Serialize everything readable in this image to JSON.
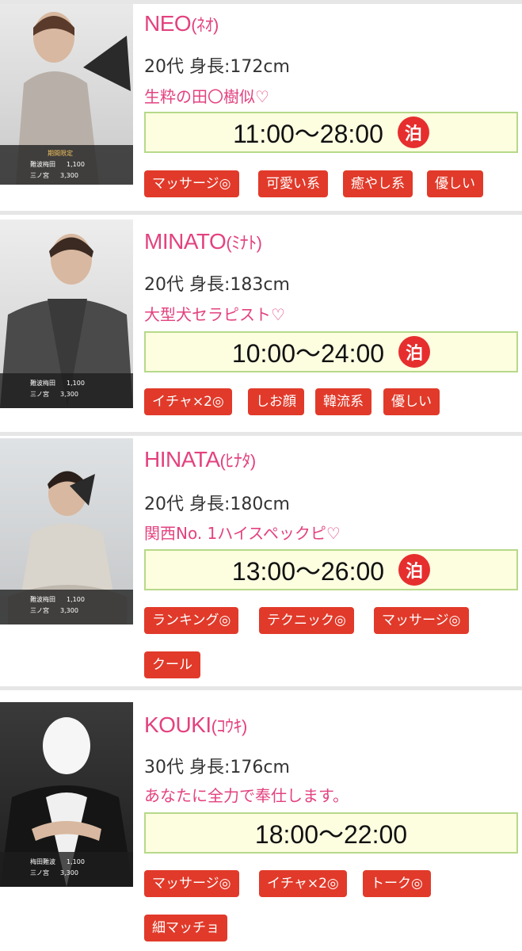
{
  "colors": {
    "accent_pink": "#e3427f",
    "tag_red": "#e13a2a",
    "hours_bg": "#fdfde0",
    "hours_border": "#b6d98a",
    "stay_red": "#e62e2e"
  },
  "therapists": [
    {
      "name": "NEO",
      "kana": "(ﾈｵ)",
      "meta": "20代 身長:172cm",
      "catch": "生粋の田〇樹似♡",
      "hours": "11:00〜28:00",
      "stay": "泊",
      "photo_limited": "期間限定",
      "photo_prices": [
        {
          "area": "難波梅田",
          "price": "1,100"
        },
        {
          "area": "三ノ宮",
          "price": "3,300"
        }
      ],
      "tags": [
        "マッサージ◎",
        "可愛い系",
        "癒やし系",
        "優しい"
      ]
    },
    {
      "name": "MINATO",
      "kana": "(ﾐﾅﾄ)",
      "meta": "20代 身長:183cm",
      "catch": "大型犬セラピスト♡",
      "hours": "10:00〜24:00",
      "stay": "泊",
      "photo_prices": [
        {
          "area": "難波梅田",
          "price": "1,100"
        },
        {
          "area": "三ノ宮",
          "price": "3,300"
        }
      ],
      "tags": [
        "イチャ×2◎",
        "しお顔",
        "韓流系",
        "優しい"
      ]
    },
    {
      "name": "HINATA",
      "kana": "(ﾋﾅﾀ)",
      "meta": "20代 身長:180cm",
      "catch": "関西No. 1ハイスペックピ♡",
      "hours": "13:00〜26:00",
      "stay": "泊",
      "photo_prices": [
        {
          "area": "難波梅田",
          "price": "1,100"
        },
        {
          "area": "三ノ宮",
          "price": "3,300"
        }
      ],
      "tags": [
        "ランキング◎",
        "テクニック◎",
        "マッサージ◎",
        "クール"
      ]
    },
    {
      "name": "KOUKI",
      "kana": "(ｺｳｷ)",
      "meta": "30代 身長:176cm",
      "catch": "あなたに全力で奉仕します。",
      "hours": "18:00〜22:00",
      "photo_prices": [
        {
          "area": "梅田難波",
          "price": "1,100"
        },
        {
          "area": "三ノ宮",
          "price": "3,300"
        }
      ],
      "tags": [
        "マッサージ◎",
        "イチャ×2◎",
        "トーク◎",
        "細マッチョ"
      ]
    }
  ]
}
